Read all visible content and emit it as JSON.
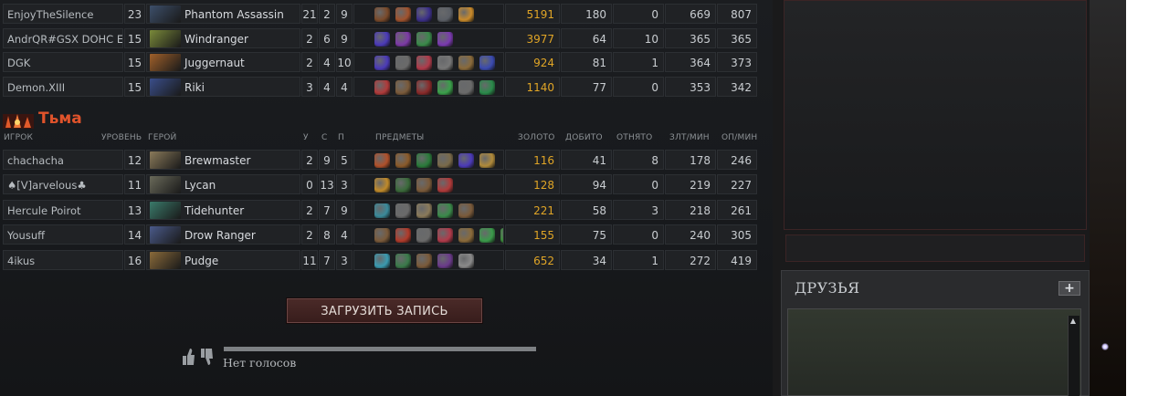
{
  "radiant_rows": [
    {
      "player": "EnjoyTheSilence",
      "level": "23",
      "hero": "Phantom Assassin",
      "portrait": "#3d4f6a",
      "k": "21",
      "d": "2",
      "a": "9",
      "items": [
        "#7a4a2a",
        "#a0522d",
        "#3b2f8a",
        "#5b5f66",
        "#c98a2a"
      ],
      "gold": "5191",
      "lh": "180",
      "dn": "0",
      "gpm": "669",
      "xpm": "807"
    },
    {
      "player": "AndrQR#GSX DOHC E",
      "level": "15",
      "hero": "Windranger",
      "portrait": "#7a8a3a",
      "k": "2",
      "d": "6",
      "a": "9",
      "items": [
        "#4b3ab8",
        "#7c3aa6",
        "#3a8a4a",
        "#7a3ab0"
      ],
      "gold": "3977",
      "lh": "64",
      "dn": "10",
      "gpm": "365",
      "xpm": "365"
    },
    {
      "player": "DGK",
      "level": "15",
      "hero": "Juggernaut",
      "portrait": "#a0602a",
      "k": "2",
      "d": "4",
      "a": "10",
      "items": [
        "#4b3ab8",
        "#6a6a6a",
        "#b03a4a",
        "#777777",
        "#8a6a3a",
        "#3a4ab0"
      ],
      "gold": "924",
      "lh": "81",
      "dn": "1",
      "gpm": "364",
      "xpm": "373"
    },
    {
      "player": "Demon.XIII",
      "level": "15",
      "hero": "Riki",
      "portrait": "#3a4e8a",
      "k": "3",
      "d": "4",
      "a": "4",
      "items": [
        "#b03a3a",
        "#7a5a3a",
        "#8a2a2a",
        "#3aa04a",
        "#6a6a6a",
        "#2a8a4a"
      ],
      "gold": "1140",
      "lh": "77",
      "dn": "0",
      "gpm": "353",
      "xpm": "342"
    }
  ],
  "dire": {
    "title": "Тьма",
    "headers": {
      "player": "ИГРОК",
      "level": "УРОВЕНЬ",
      "hero": "ГЕРОЙ",
      "k": "У",
      "d": "С",
      "a": "П",
      "items": "ПРЕДМЕТЫ",
      "gold": "ЗОЛОТО",
      "lh": "ДОБИТО",
      "dn": "ОТНЯТО",
      "gpm": "ЗЛТ/МИН",
      "xpm": "ОП/МИН"
    },
    "rows": [
      {
        "player": "chachacha",
        "level": "12",
        "hero": "Brewmaster",
        "portrait": "#8a7a5a",
        "k": "2",
        "d": "9",
        "a": "5",
        "items": [
          "#b0502a",
          "#8a5a2a",
          "#2a7a3a",
          "#7a6a4a",
          "#4b3ab8",
          "#b08a3a"
        ],
        "gold": "116",
        "lh": "41",
        "dn": "8",
        "gpm": "178",
        "xpm": "246"
      },
      {
        "player": "♠[V]arvelous♣",
        "level": "11",
        "hero": "Lycan",
        "portrait": "#6a6a5a",
        "k": "0",
        "d": "13",
        "a": "3",
        "items": [
          "#c08a2a",
          "#3a6a3a",
          "#7a5a3a",
          "#b03a3a"
        ],
        "gold": "128",
        "lh": "94",
        "dn": "0",
        "gpm": "219",
        "xpm": "227"
      },
      {
        "player": "Hercule Poirot",
        "level": "13",
        "hero": "Tidehunter",
        "portrait": "#3a7a6a",
        "k": "2",
        "d": "7",
        "a": "9",
        "items": [
          "#3a8a9a",
          "#6a6a6a",
          "#8a7a5a",
          "#3a8a4a",
          "#7a5a3a"
        ],
        "gold": "221",
        "lh": "58",
        "dn": "3",
        "gpm": "218",
        "xpm": "261"
      },
      {
        "player": "Yousuff",
        "level": "14",
        "hero": "Drow Ranger",
        "portrait": "#4a5a8a",
        "k": "2",
        "d": "8",
        "a": "4",
        "items": [
          "#7a5a3a",
          "#b03a2a",
          "#6a6a6a",
          "#b03a4a",
          "#8a6a3a",
          "#3a9a4a",
          "#3a8a3a"
        ],
        "gold": "155",
        "lh": "75",
        "dn": "0",
        "gpm": "240",
        "xpm": "305"
      },
      {
        "player": "4ikus",
        "level": "16",
        "hero": "Pudge",
        "portrait": "#8a6a3a",
        "k": "11",
        "d": "7",
        "a": "3",
        "items": [
          "#3a9ab0",
          "#3a7a4a",
          "#7a5a3a",
          "#6a3a8a",
          "#8a8a8a"
        ],
        "gold": "652",
        "lh": "34",
        "dn": "1",
        "gpm": "272",
        "xpm": "419"
      }
    ]
  },
  "replay_button": "ЗАГРУЗИТЬ ЗАПИСЬ",
  "votes_text": "Нет голосов",
  "friends_title": "ДРУЗЬЯ",
  "friends_add": "+",
  "scroll_up": "▲"
}
